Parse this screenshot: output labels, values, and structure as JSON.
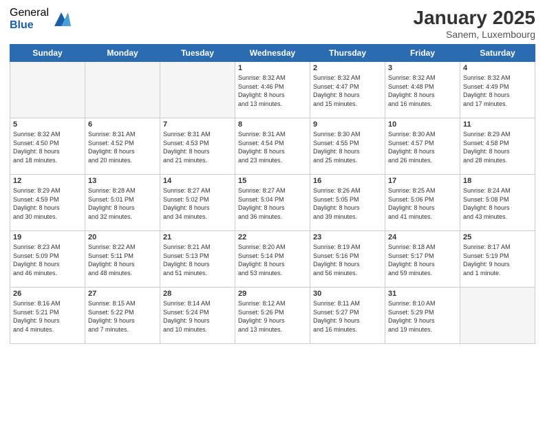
{
  "header": {
    "logo_general": "General",
    "logo_blue": "Blue",
    "title": "January 2025",
    "subtitle": "Sanem, Luxembourg"
  },
  "weekdays": [
    "Sunday",
    "Monday",
    "Tuesday",
    "Wednesday",
    "Thursday",
    "Friday",
    "Saturday"
  ],
  "weeks": [
    [
      {
        "day": "",
        "info": ""
      },
      {
        "day": "",
        "info": ""
      },
      {
        "day": "",
        "info": ""
      },
      {
        "day": "1",
        "info": "Sunrise: 8:32 AM\nSunset: 4:46 PM\nDaylight: 8 hours\nand 13 minutes."
      },
      {
        "day": "2",
        "info": "Sunrise: 8:32 AM\nSunset: 4:47 PM\nDaylight: 8 hours\nand 15 minutes."
      },
      {
        "day": "3",
        "info": "Sunrise: 8:32 AM\nSunset: 4:48 PM\nDaylight: 8 hours\nand 16 minutes."
      },
      {
        "day": "4",
        "info": "Sunrise: 8:32 AM\nSunset: 4:49 PM\nDaylight: 8 hours\nand 17 minutes."
      }
    ],
    [
      {
        "day": "5",
        "info": "Sunrise: 8:32 AM\nSunset: 4:50 PM\nDaylight: 8 hours\nand 18 minutes."
      },
      {
        "day": "6",
        "info": "Sunrise: 8:31 AM\nSunset: 4:52 PM\nDaylight: 8 hours\nand 20 minutes."
      },
      {
        "day": "7",
        "info": "Sunrise: 8:31 AM\nSunset: 4:53 PM\nDaylight: 8 hours\nand 21 minutes."
      },
      {
        "day": "8",
        "info": "Sunrise: 8:31 AM\nSunset: 4:54 PM\nDaylight: 8 hours\nand 23 minutes."
      },
      {
        "day": "9",
        "info": "Sunrise: 8:30 AM\nSunset: 4:55 PM\nDaylight: 8 hours\nand 25 minutes."
      },
      {
        "day": "10",
        "info": "Sunrise: 8:30 AM\nSunset: 4:57 PM\nDaylight: 8 hours\nand 26 minutes."
      },
      {
        "day": "11",
        "info": "Sunrise: 8:29 AM\nSunset: 4:58 PM\nDaylight: 8 hours\nand 28 minutes."
      }
    ],
    [
      {
        "day": "12",
        "info": "Sunrise: 8:29 AM\nSunset: 4:59 PM\nDaylight: 8 hours\nand 30 minutes."
      },
      {
        "day": "13",
        "info": "Sunrise: 8:28 AM\nSunset: 5:01 PM\nDaylight: 8 hours\nand 32 minutes."
      },
      {
        "day": "14",
        "info": "Sunrise: 8:27 AM\nSunset: 5:02 PM\nDaylight: 8 hours\nand 34 minutes."
      },
      {
        "day": "15",
        "info": "Sunrise: 8:27 AM\nSunset: 5:04 PM\nDaylight: 8 hours\nand 36 minutes."
      },
      {
        "day": "16",
        "info": "Sunrise: 8:26 AM\nSunset: 5:05 PM\nDaylight: 8 hours\nand 39 minutes."
      },
      {
        "day": "17",
        "info": "Sunrise: 8:25 AM\nSunset: 5:06 PM\nDaylight: 8 hours\nand 41 minutes."
      },
      {
        "day": "18",
        "info": "Sunrise: 8:24 AM\nSunset: 5:08 PM\nDaylight: 8 hours\nand 43 minutes."
      }
    ],
    [
      {
        "day": "19",
        "info": "Sunrise: 8:23 AM\nSunset: 5:09 PM\nDaylight: 8 hours\nand 46 minutes."
      },
      {
        "day": "20",
        "info": "Sunrise: 8:22 AM\nSunset: 5:11 PM\nDaylight: 8 hours\nand 48 minutes."
      },
      {
        "day": "21",
        "info": "Sunrise: 8:21 AM\nSunset: 5:13 PM\nDaylight: 8 hours\nand 51 minutes."
      },
      {
        "day": "22",
        "info": "Sunrise: 8:20 AM\nSunset: 5:14 PM\nDaylight: 8 hours\nand 53 minutes."
      },
      {
        "day": "23",
        "info": "Sunrise: 8:19 AM\nSunset: 5:16 PM\nDaylight: 8 hours\nand 56 minutes."
      },
      {
        "day": "24",
        "info": "Sunrise: 8:18 AM\nSunset: 5:17 PM\nDaylight: 8 hours\nand 59 minutes."
      },
      {
        "day": "25",
        "info": "Sunrise: 8:17 AM\nSunset: 5:19 PM\nDaylight: 9 hours\nand 1 minute."
      }
    ],
    [
      {
        "day": "26",
        "info": "Sunrise: 8:16 AM\nSunset: 5:21 PM\nDaylight: 9 hours\nand 4 minutes."
      },
      {
        "day": "27",
        "info": "Sunrise: 8:15 AM\nSunset: 5:22 PM\nDaylight: 9 hours\nand 7 minutes."
      },
      {
        "day": "28",
        "info": "Sunrise: 8:14 AM\nSunset: 5:24 PM\nDaylight: 9 hours\nand 10 minutes."
      },
      {
        "day": "29",
        "info": "Sunrise: 8:12 AM\nSunset: 5:26 PM\nDaylight: 9 hours\nand 13 minutes."
      },
      {
        "day": "30",
        "info": "Sunrise: 8:11 AM\nSunset: 5:27 PM\nDaylight: 9 hours\nand 16 minutes."
      },
      {
        "day": "31",
        "info": "Sunrise: 8:10 AM\nSunset: 5:29 PM\nDaylight: 9 hours\nand 19 minutes."
      },
      {
        "day": "",
        "info": ""
      }
    ]
  ]
}
